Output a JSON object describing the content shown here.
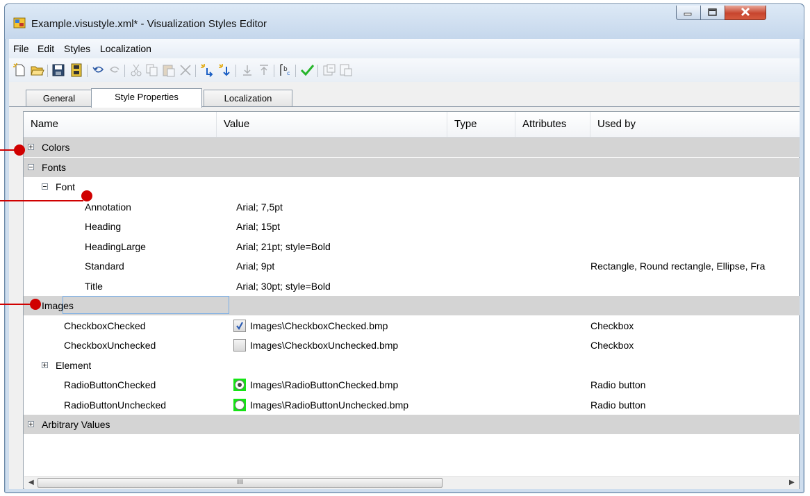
{
  "window": {
    "title": "Example.visustyle.xml* - Visualization Styles Editor"
  },
  "menu": {
    "items": [
      "File",
      "Edit",
      "Styles",
      "Localization"
    ]
  },
  "toolbar": {
    "icons": [
      "new-icon",
      "open-icon",
      "save-icon",
      "save-all-icon",
      "undo-icon",
      "redo-icon",
      "cut-icon",
      "copy-icon",
      "paste-icon",
      "delete-icon",
      "add-icon",
      "add-child-icon",
      "move-down-icon",
      "move-up-icon",
      "spell-check-icon",
      "check-icon",
      "import-icon",
      "export-icon"
    ]
  },
  "tabs": [
    {
      "label": "General",
      "active": false
    },
    {
      "label": "Style Properties",
      "active": true
    },
    {
      "label": "Localization",
      "active": false
    }
  ],
  "grid": {
    "columns": [
      "Name",
      "Value",
      "Type",
      "Attributes",
      "Used by"
    ],
    "rows": [
      {
        "name": "Colors",
        "value": "",
        "used_by": "",
        "kind": "category",
        "expander": "plus"
      },
      {
        "name": "Fonts",
        "value": "",
        "used_by": "",
        "kind": "category",
        "expander": "minus"
      },
      {
        "name": "Font",
        "value": "",
        "used_by": "",
        "kind": "group",
        "expander": "minus"
      },
      {
        "name": "Annotation",
        "value": "Arial; 7,5pt",
        "used_by": "",
        "kind": "leaf3"
      },
      {
        "name": "Heading",
        "value": "Arial; 15pt",
        "used_by": "",
        "kind": "leaf3"
      },
      {
        "name": "HeadingLarge",
        "value": "Arial; 21pt; style=Bold",
        "used_by": "",
        "kind": "leaf3"
      },
      {
        "name": "Standard",
        "value": "Arial; 9pt",
        "used_by": "Rectangle, Round rectangle, Ellipse, Fra",
        "kind": "leaf3"
      },
      {
        "name": "Title",
        "value": "Arial; 30pt; style=Bold",
        "used_by": "",
        "kind": "leaf3"
      },
      {
        "name": "Images",
        "value": "",
        "used_by": "",
        "kind": "category-selected"
      },
      {
        "name": "CheckboxChecked",
        "value": "Images\\CheckboxChecked.bmp",
        "used_by": "Checkbox",
        "kind": "image-check",
        "checked": true
      },
      {
        "name": "CheckboxUnchecked",
        "value": "Images\\CheckboxUnchecked.bmp",
        "used_by": "Checkbox",
        "kind": "image-check",
        "checked": false
      },
      {
        "name": "Element",
        "value": "",
        "used_by": "",
        "kind": "group2",
        "expander": "plus"
      },
      {
        "name": "RadioButtonChecked",
        "value": "Images\\RadioButtonChecked.bmp",
        "used_by": "Radio button",
        "kind": "image-radio",
        "checked": true
      },
      {
        "name": "RadioButtonUnchecked",
        "value": "Images\\RadioButtonUnchecked.bmp",
        "used_by": "Radio button",
        "kind": "image-radio",
        "checked": false
      },
      {
        "name": "Arbitrary Values",
        "value": "",
        "used_by": "",
        "kind": "category",
        "expander": "plus"
      }
    ]
  },
  "scrollbar": {
    "grip": "III",
    "left_arrow": "◀",
    "right_arrow": "▶"
  },
  "colors": {
    "callout": "#d00000",
    "category_row": "#d4d4d4",
    "selection_border": "#7aaee6"
  }
}
